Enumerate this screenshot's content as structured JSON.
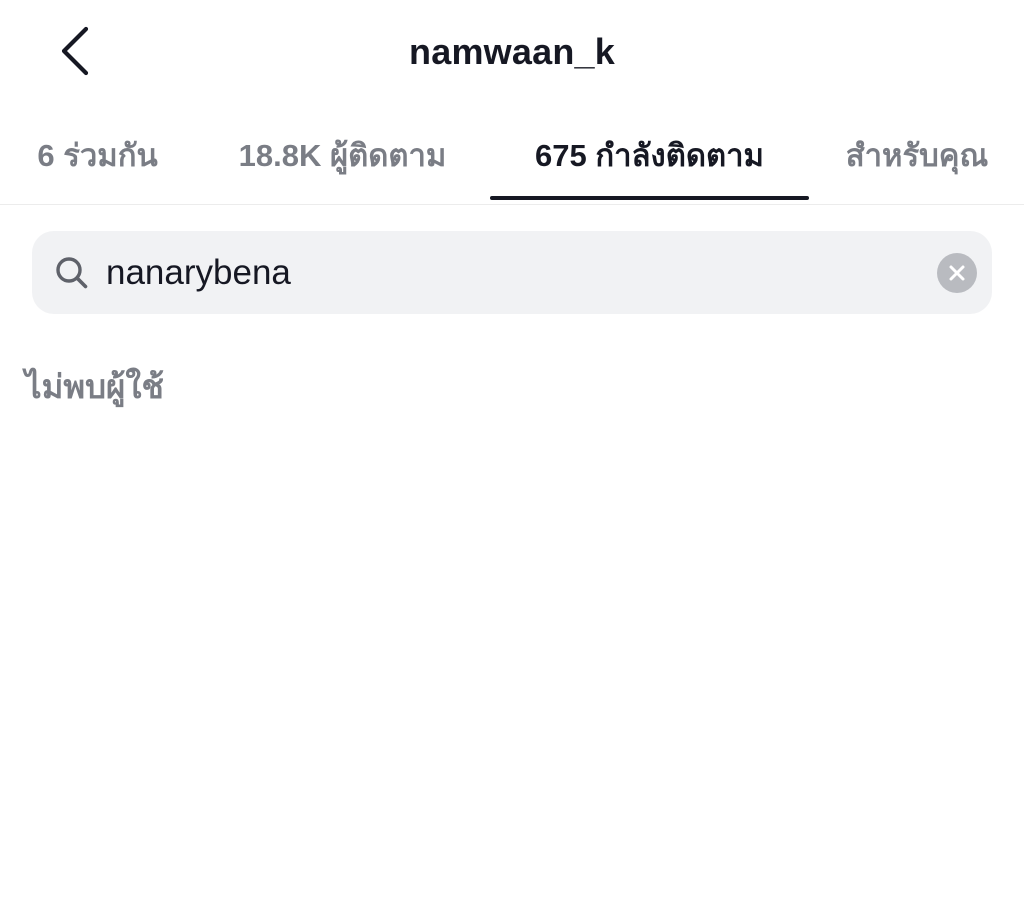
{
  "header": {
    "title": "namwaan_k",
    "back_icon": "chevron-left-icon"
  },
  "tabs": [
    {
      "label": "6 ร่วมกัน",
      "active": false
    },
    {
      "label": "18.8K ผู้ติดตาม",
      "active": false
    },
    {
      "label": "675 กำลังติดตาม",
      "active": true
    },
    {
      "label": "สำหรับคุณ",
      "active": false
    }
  ],
  "search": {
    "value": "nanarybena",
    "icon": "search-icon",
    "clear_icon": "clear-icon"
  },
  "results": {
    "empty_message": "ไม่พบผู้ใช้"
  },
  "colors": {
    "primary_text": "#161823",
    "secondary_text": "#7a7d85",
    "search_bg": "#f1f2f4",
    "clear_bg": "#b9bbc0"
  }
}
